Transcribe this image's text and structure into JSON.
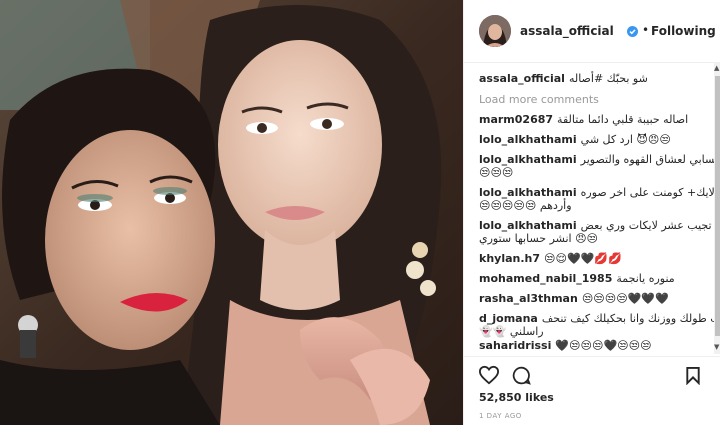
{
  "header": {
    "username": "assala_official",
    "separator": "•",
    "follow_status": "Following"
  },
  "caption": {
    "username": "assala_official",
    "text": "شو بحبّك #أصاله"
  },
  "load_more": "Load more comments",
  "comments": [
    {
      "user": "marm02687",
      "text": "اصاله حبيبة قلبي دائما متالقة"
    },
    {
      "user": "lolo_alkhathami",
      "text": "😒😠😈 ارد كل شي"
    },
    {
      "user": "lolo_alkhathami",
      "text": "☕ حسابي لعشاق القهوه والتصوير"
    },
    {
      "user": "",
      "text": "😒😒😒"
    },
    {
      "user": "lolo_alkhathami",
      "text": "لايك+ كومنت على اخر صوره"
    },
    {
      "user": "",
      "text": "وأردهم 😒😒😒😒😒"
    },
    {
      "user": "lolo_alkhathami",
      "text": "اللي تجيب عشر لايكات وري بعض"
    },
    {
      "user": "",
      "text": "😒😠 انشر حسابها ستوري"
    },
    {
      "user": "khylan.h7",
      "text": "💋💋🖤🖤😌😒"
    },
    {
      "user": "mohamed_nabil_1985",
      "text": "منوره يانجمة"
    },
    {
      "user": "rasha_al3thman",
      "text": "🖤🖤🖤😒😒😒😒"
    },
    {
      "user": "d_jomana",
      "text": "ابعت طولك ووزنك وانا بحكيلك كيف تنحف"
    },
    {
      "user": "",
      "text": "راسلني 👻👻"
    },
    {
      "user": "saharidrissi",
      "text": "😒😒😒🖤😒😒😒🖤"
    }
  ],
  "likes": "52,850 likes",
  "timestamp": "1 DAY AGO",
  "icons": {
    "heart": "heart-icon",
    "comment": "comment-icon",
    "bookmark": "bookmark-icon",
    "verified": "verified-badge-icon"
  },
  "colors": {
    "verified": "#3897f0",
    "text": "#262626",
    "muted": "#999999"
  }
}
